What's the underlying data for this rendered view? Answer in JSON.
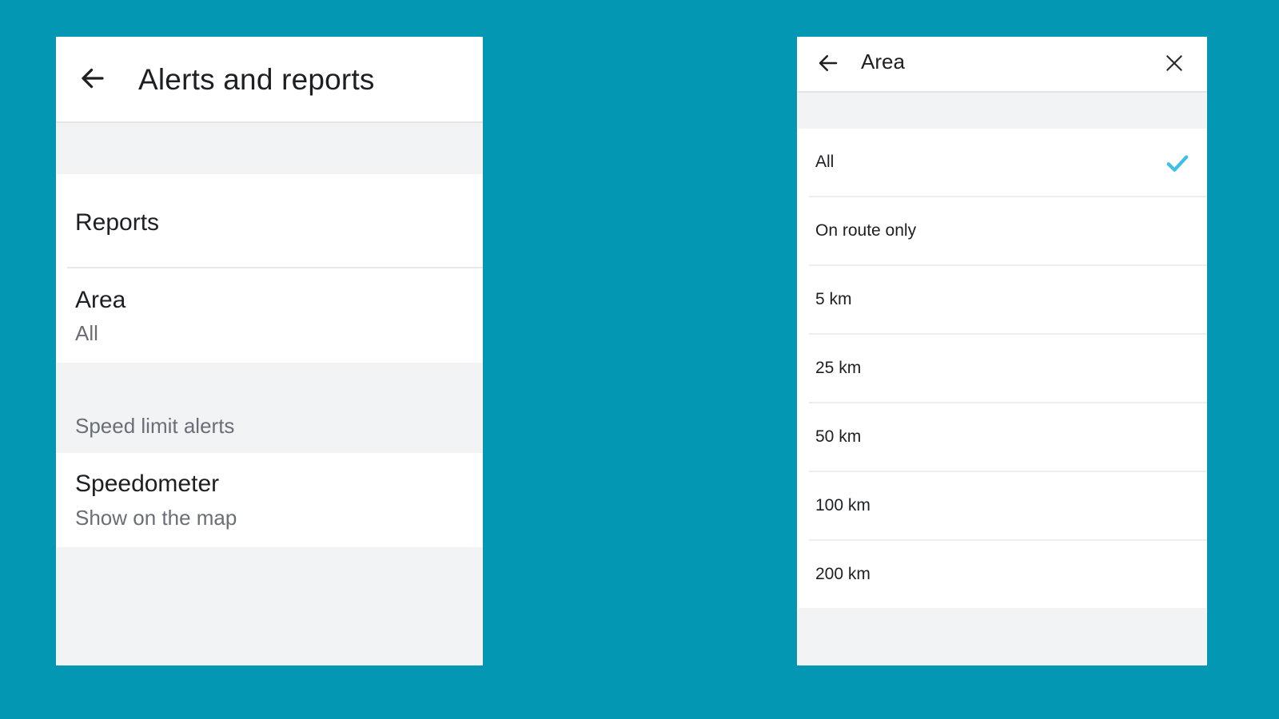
{
  "left_panel": {
    "title": "Alerts and reports",
    "reports_label": "Reports",
    "area": {
      "label": "Area",
      "value": "All"
    },
    "speed_section_label": "Speed limit alerts",
    "speedometer": {
      "label": "Speedometer",
      "value": "Show on the map"
    }
  },
  "right_panel": {
    "title": "Area",
    "options": [
      {
        "label": "All",
        "selected": true
      },
      {
        "label": "On route only",
        "selected": false
      },
      {
        "label": "5 km",
        "selected": false
      },
      {
        "label": "25 km",
        "selected": false
      },
      {
        "label": "50 km",
        "selected": false
      },
      {
        "label": "100 km",
        "selected": false
      },
      {
        "label": "200 km",
        "selected": false
      }
    ]
  },
  "icons": {
    "back": "arrow-left-icon",
    "close": "close-icon",
    "check": "checkmark-icon"
  },
  "colors": {
    "background": "#0397b3",
    "check": "#3fbfe8"
  }
}
